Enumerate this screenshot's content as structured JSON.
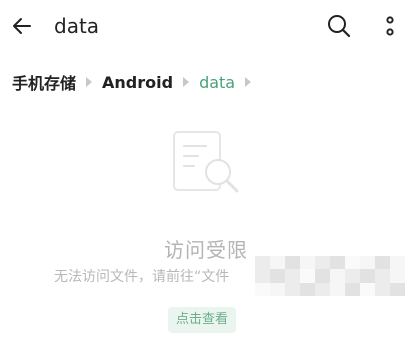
{
  "appbar": {
    "title": "data",
    "icons": {
      "back": "back-arrow-icon",
      "search": "search-icon",
      "more": "more-vertical-icon"
    }
  },
  "breadcrumb": {
    "items": [
      "手机存储",
      "Android",
      "data"
    ]
  },
  "empty_state": {
    "icon": "document-search-icon",
    "title": "访问受限",
    "description": "无法访问文件，请前往“文件"
  },
  "action": {
    "label": "点击查看"
  },
  "colors": {
    "accent": "#4aa07a",
    "muted_text": "#b4b4b4",
    "button_bg": "#eaf5ef"
  }
}
